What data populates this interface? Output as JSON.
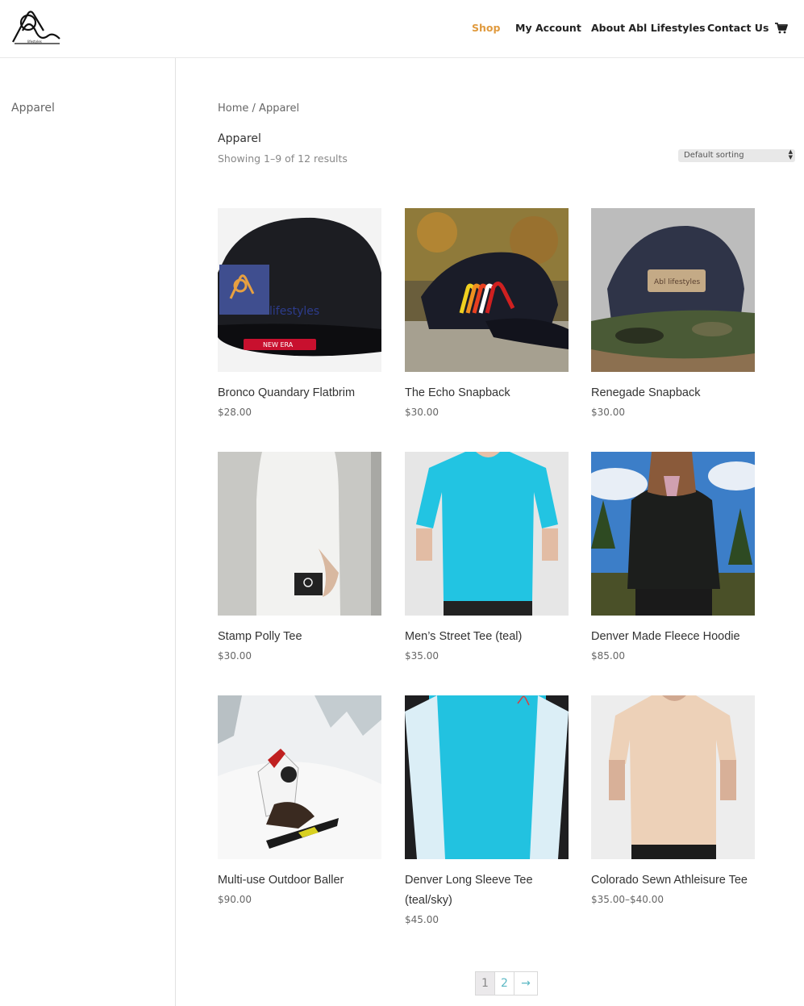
{
  "header": {
    "logo_alt": "Abl Lifestyles logo",
    "nav": [
      {
        "label": "Shop",
        "active": true
      },
      {
        "label": "My Account",
        "active": false
      },
      {
        "label": "About Abl Lifestyles",
        "active": false
      },
      {
        "label": "Contact Us",
        "active": false
      }
    ],
    "cart_icon": "shopping-cart-icon"
  },
  "sidebar": {
    "categories": [
      "Apparel"
    ]
  },
  "main": {
    "breadcrumb": {
      "home": "Home",
      "separator": " / ",
      "current": "Apparel"
    },
    "title": "Apparel",
    "result_count": "Showing 1–9 of 12 results",
    "sort": {
      "selected": "Default sorting"
    }
  },
  "products": [
    {
      "name": "Bronco Quandary Flatbrim",
      "price": "$28.00"
    },
    {
      "name": "The Echo Snapback",
      "price": "$30.00"
    },
    {
      "name": "Renegade Snapback",
      "price": "$30.00"
    },
    {
      "name": "Stamp Polly Tee",
      "price": "$30.00"
    },
    {
      "name": "Men’s Street Tee (teal)",
      "price": "$35.00"
    },
    {
      "name": "Denver Made Fleece Hoodie",
      "price": "$85.00"
    },
    {
      "name": "Multi-use Outdoor Baller",
      "price": "$90.00"
    },
    {
      "name": "Denver Long Sleeve Tee (teal/sky)",
      "price": "$45.00"
    },
    {
      "name": "Colorado Sewn Athleisure Tee",
      "price": "$35.00–$40.00"
    }
  ],
  "pagination": {
    "pages": [
      "1",
      "2"
    ],
    "current": "1",
    "next": "→"
  },
  "colors": {
    "accent": "#e09a3e",
    "link": "#5bb8c4",
    "text": "#333333"
  }
}
